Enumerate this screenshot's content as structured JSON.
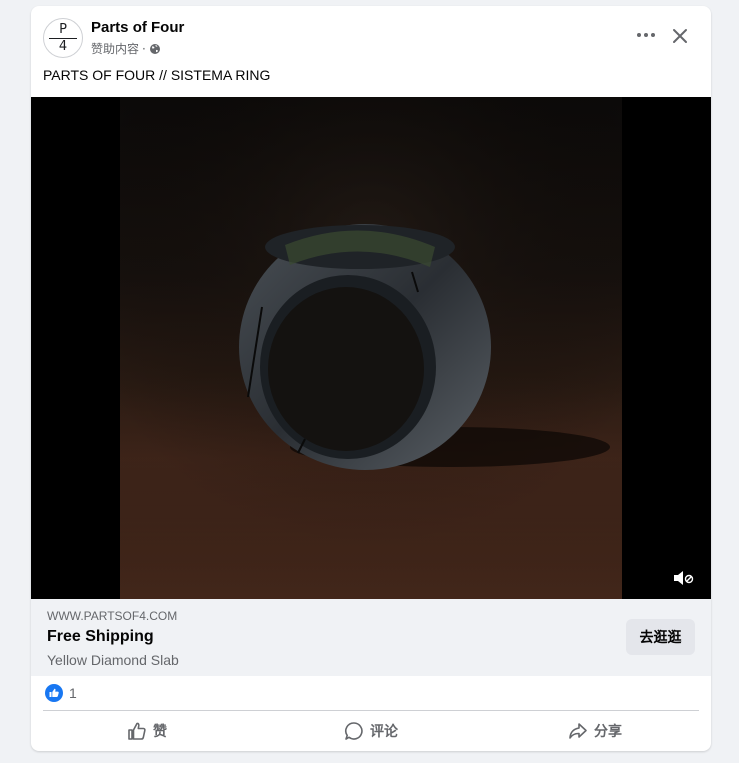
{
  "post": {
    "page_name": "Parts of Four",
    "avatar_top": "P",
    "avatar_bottom": "4",
    "sponsored_label": "赞助内容",
    "sponsored_separator": "·",
    "text": "PARTS OF FOUR // SISTEMA RING"
  },
  "link_preview": {
    "domain": "WWW.PARTSOF4.COM",
    "title": "Free Shipping",
    "description": "Yellow Diamond Slab",
    "cta_label": "去逛逛"
  },
  "reactions": {
    "count": "1"
  },
  "actions": [
    {
      "label": "赞",
      "icon": "like-icon"
    },
    {
      "label": "评论",
      "icon": "comment-icon"
    },
    {
      "label": "分享",
      "icon": "share-icon"
    }
  ],
  "colors": {
    "like_blue": "#1877f2",
    "text_primary": "#050505",
    "text_secondary": "#65676b",
    "background": "#f0f2f5"
  }
}
